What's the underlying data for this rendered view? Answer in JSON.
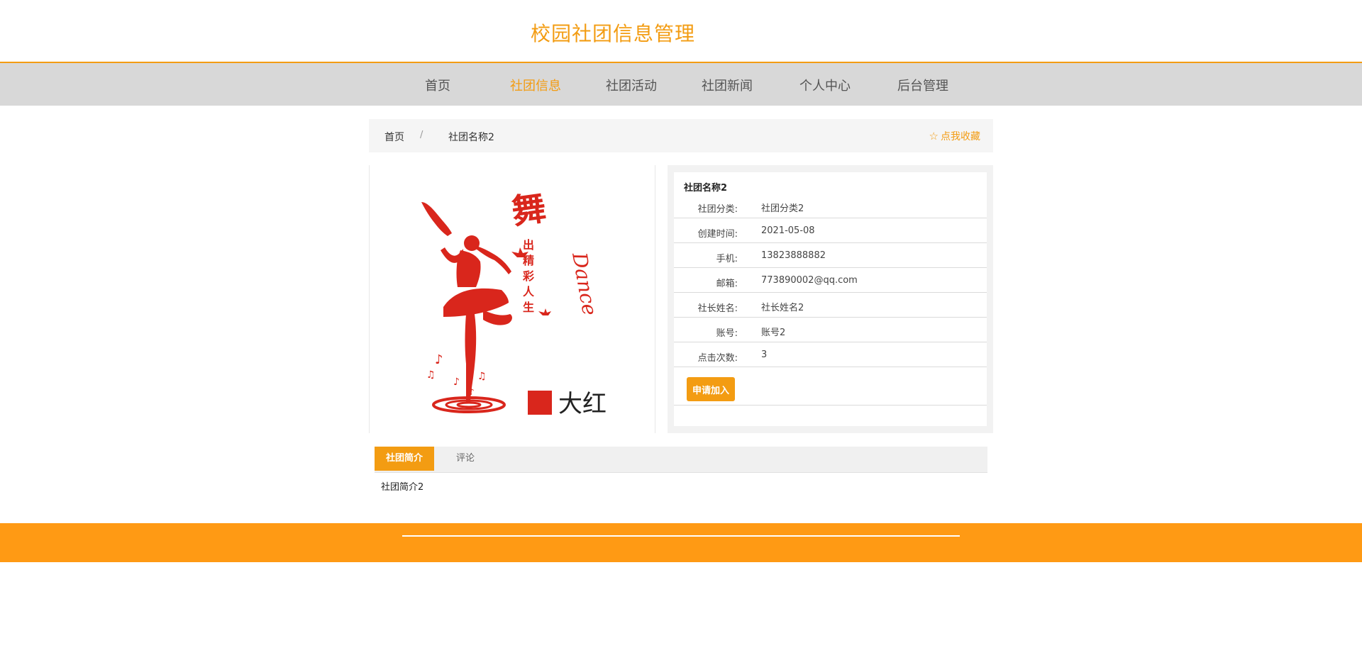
{
  "header": {
    "title": "校园社团信息管理"
  },
  "nav": {
    "items": [
      {
        "label": "首页"
      },
      {
        "label": "社团信息"
      },
      {
        "label": "社团活动"
      },
      {
        "label": "社团新闻"
      },
      {
        "label": "个人中心"
      },
      {
        "label": "后台管理"
      }
    ],
    "active_index": 1
  },
  "breadcrumb": {
    "home": "首页",
    "separator": "/",
    "current": "社团名称2"
  },
  "favorite": {
    "icon": "star-outline-icon",
    "label": "点我收藏"
  },
  "image": {
    "vertical_text": [
      "舞",
      "出",
      "精",
      "彩",
      "人",
      "生"
    ],
    "script_text": "Dance",
    "color_label": "大红",
    "accent_color": "#D9261C"
  },
  "info": {
    "title": "社团名称2",
    "rows": [
      {
        "label": "社团分类:",
        "value": "社团分类2"
      },
      {
        "label": "创建时间:",
        "value": "2021-05-08"
      },
      {
        "label": "手机:",
        "value": "13823888882"
      },
      {
        "label": "邮箱:",
        "value": "773890002@qq.com"
      },
      {
        "label": "社长姓名:",
        "value": "社长姓名2"
      },
      {
        "label": "账号:",
        "value": "账号2"
      },
      {
        "label": "点击次数:",
        "value": "3"
      }
    ],
    "apply_button": "申请加入"
  },
  "tabs": {
    "items": [
      {
        "label": "社团简介"
      },
      {
        "label": "评论"
      }
    ],
    "active_index": 0,
    "content": "社团简介2"
  },
  "colors": {
    "brand": "#F39C12",
    "nav_bg": "#D8D8D8",
    "footer": "#FF9A14"
  }
}
